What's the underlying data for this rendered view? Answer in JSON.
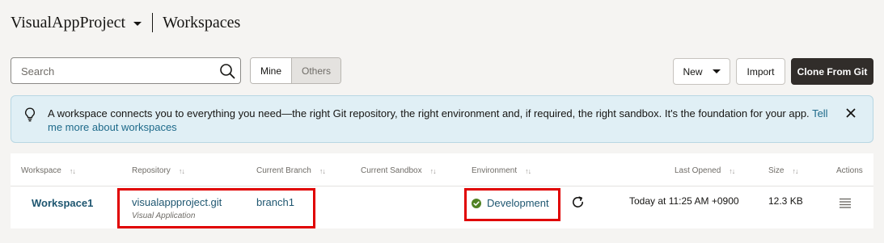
{
  "header": {
    "project_name": "VisualAppProject",
    "page_title": "Workspaces"
  },
  "toolbar": {
    "search_placeholder": "Search",
    "filter_mine": "Mine",
    "filter_others": "Others",
    "new_label": "New",
    "import_label": "Import",
    "clone_label": "Clone From Git"
  },
  "banner": {
    "message": "A workspace connects you to everything you need—the right Git repository, the right environment and, if required, the right sandbox. It's the foundation for your app.",
    "link_text": "Tell me more about workspaces"
  },
  "table": {
    "columns": {
      "workspace": "Workspace",
      "repository": "Repository",
      "current_branch": "Current Branch",
      "current_sandbox": "Current Sandbox",
      "environment": "Environment",
      "last_opened": "Last Opened",
      "size": "Size",
      "actions": "Actions"
    },
    "rows": [
      {
        "workspace": "Workspace1",
        "repository": "visualappproject.git",
        "repository_type": "Visual Application",
        "branch": "branch1",
        "sandbox": "",
        "environment": "Development",
        "last_opened": "Today at 11:25 AM +0900",
        "size": "12.3 KB"
      }
    ]
  },
  "colors": {
    "primary_button": "#312d2a",
    "banner_bg": "#e0eff5",
    "link": "#1e5670",
    "success": "#508223",
    "highlight": "#e00000"
  }
}
